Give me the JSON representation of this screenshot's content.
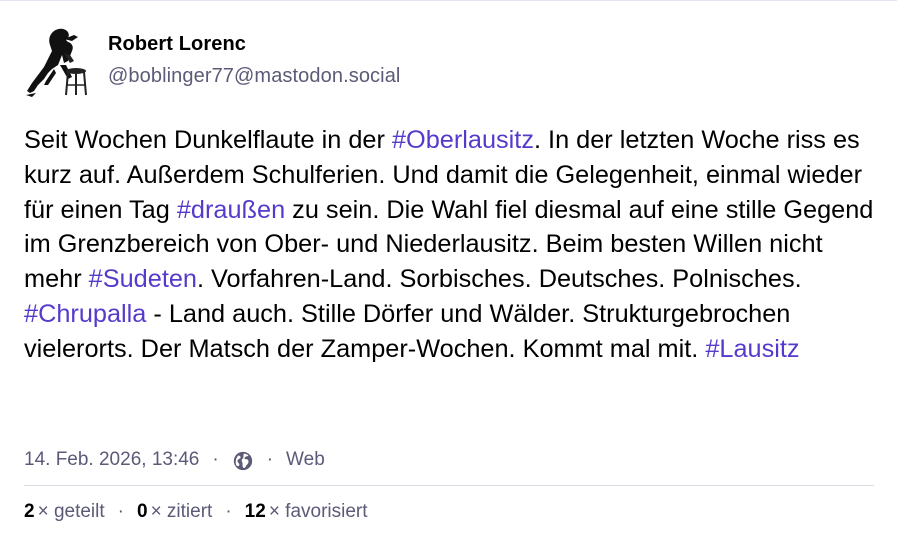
{
  "account": {
    "display_name": "Robert Lorenc",
    "handle": "@boblinger77@mastodon.social"
  },
  "status": {
    "segments": [
      {
        "text": "Seit Wochen Dunkelflaute in der ",
        "link": false
      },
      {
        "text": "#Oberlausitz",
        "link": true
      },
      {
        "text": ". In der letzten Woche riss es kurz auf. Außerdem Schulferien. Und damit die Gelegenheit, einmal wieder für einen Tag ",
        "link": false
      },
      {
        "text": "#draußen",
        "link": true
      },
      {
        "text": " zu sein. Die Wahl fiel diesmal auf eine stille Gegend im Grenzbereich von Ober- und Niederlausitz. Beim besten Willen nicht mehr ",
        "link": false
      },
      {
        "text": "#Sudeten",
        "link": true
      },
      {
        "text": ". Vorfahren-Land. Sorbisches. Deutsches. Polnisches. ",
        "link": false
      },
      {
        "text": "#Chrupalla",
        "link": true
      },
      {
        "text": " - Land auch. Stille Dörfer und Wälder. Strukturgebrochen vielerorts. Der Matsch der Zamper-Wochen. Kommt mal mit. ",
        "link": false
      },
      {
        "text": "#Lausitz",
        "link": true
      }
    ]
  },
  "meta": {
    "timestamp": "14. Feb. 2026, 13:46",
    "separator": "·",
    "visibility_icon": "globe-icon",
    "application": "Web"
  },
  "counts": {
    "reblogs": "2",
    "reblogs_label": "× geteilt",
    "quotes": "0",
    "quotes_label": "× zitiert",
    "favourites": "12",
    "favourites_label": "× favorisiert",
    "separator": "·"
  },
  "colors": {
    "link": "#563acc",
    "muted": "#5b5a77",
    "divider": "#dcdbe4"
  }
}
